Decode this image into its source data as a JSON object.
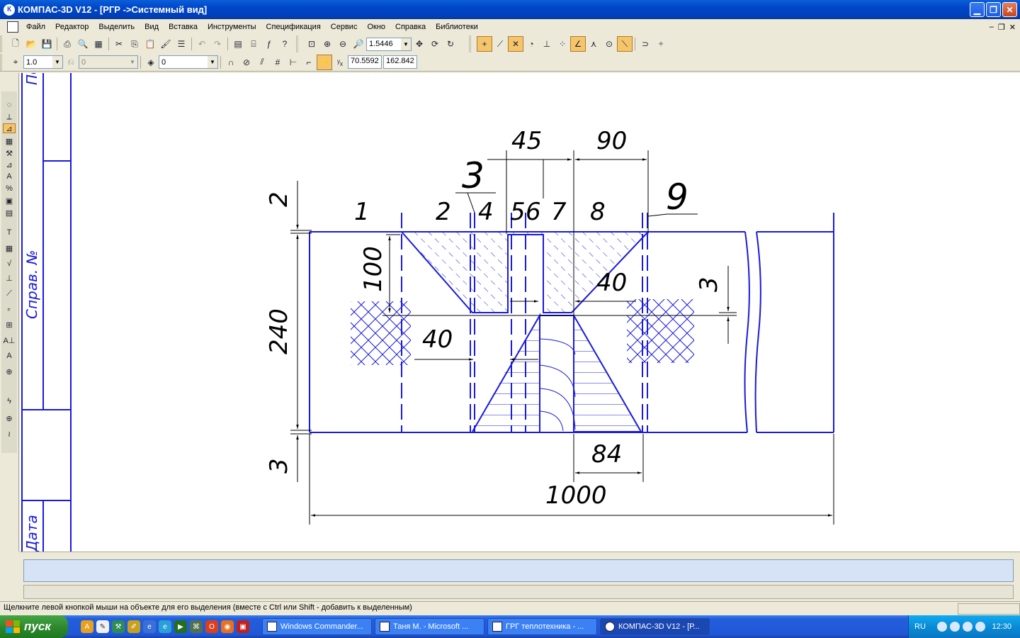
{
  "window": {
    "title": "КОМПАС-3D V12 - [РГР ->Системный вид]",
    "icon": "kompas-icon",
    "controls": [
      "minimize",
      "restore",
      "close"
    ]
  },
  "menu": {
    "items": [
      "Файл",
      "Редактор",
      "Выделить",
      "Вид",
      "Вставка",
      "Инструменты",
      "Спецификация",
      "Сервис",
      "Окно",
      "Справка",
      "Библиотеки"
    ]
  },
  "toolbar": {
    "zoom_value": "1.5446",
    "line_scale_value": "1.0",
    "angle_value": "0",
    "layer_value": "0",
    "coord_x": "70.5592",
    "coord_y": "162.842"
  },
  "drawing": {
    "title_block_texts": [
      "Справ. №",
      "Подп.",
      "Дата"
    ],
    "dimensions": {
      "d45": "45",
      "d90": "90",
      "d2": "2",
      "d240": "240",
      "d100": "100",
      "d40_left": "40",
      "d40_right": "40",
      "d3_right": "3",
      "d3_bottom": "3",
      "d84": "84",
      "d1000": "1000"
    },
    "position_labels": {
      "p1": "1",
      "p2": "2",
      "p3": "3",
      "p4": "4",
      "p5": "5",
      "p6": "6",
      "p7": "7",
      "p8": "8",
      "p9": "9"
    }
  },
  "status": {
    "hint": "Щелкните левой кнопкой мыши на объекте для его выделения (вместе с Ctrl или Shift - добавить к выделенным)"
  },
  "taskbar": {
    "start_label": "пуск",
    "tasks": [
      {
        "label": "Windows Commander...",
        "active": false
      },
      {
        "label": "Таня М. - Microsoft ...",
        "active": false
      },
      {
        "label": "ГРГ теплотехника - ...",
        "active": false
      },
      {
        "label": "КОМПАС-3D V12 - [Р...",
        "active": true
      }
    ],
    "language": "RU",
    "clock": "12:30"
  },
  "colors": {
    "drawing_line": "#1a1adc",
    "dim_line": "#000000",
    "selected_tool": "#f5c56b",
    "titlebar": "#0046c8",
    "taskbar": "#245edb"
  }
}
